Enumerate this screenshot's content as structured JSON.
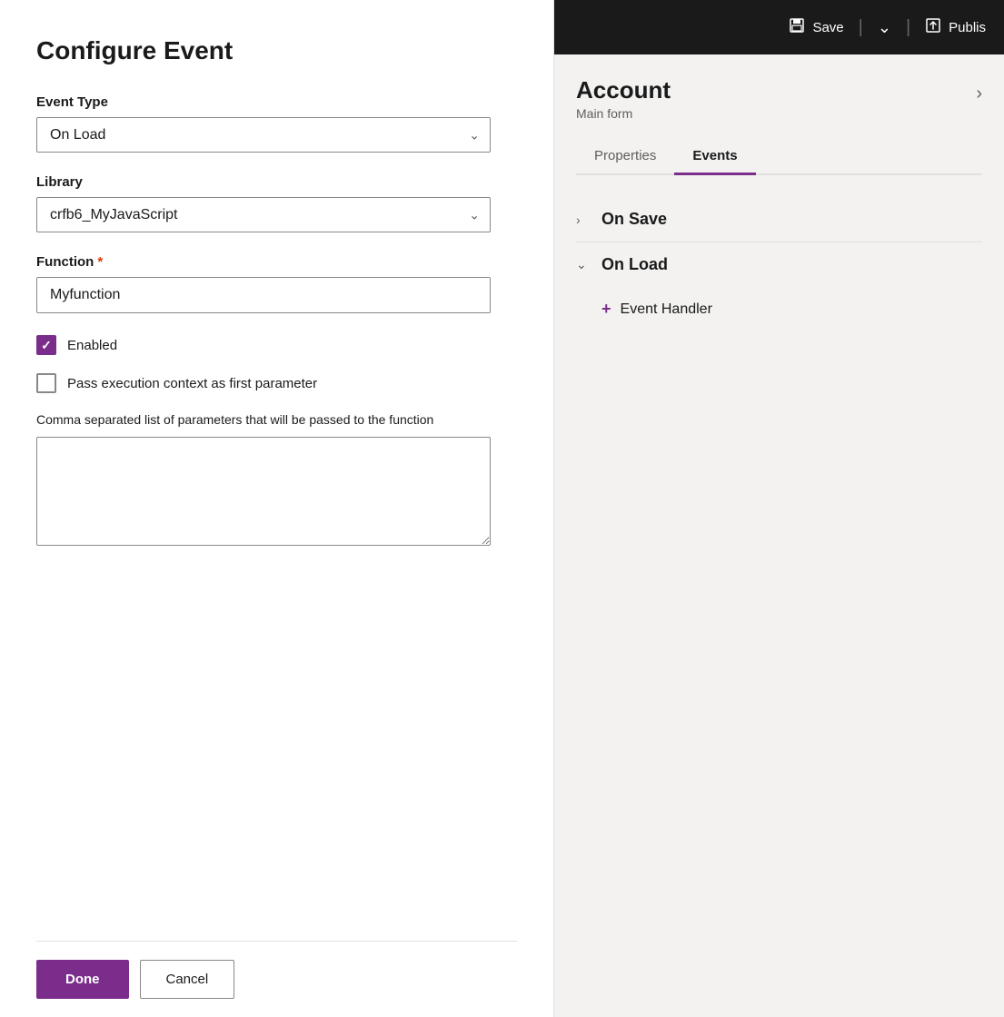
{
  "dialog": {
    "title": "Configure Event",
    "event_type_label": "Event Type",
    "event_type_value": "On Load",
    "library_label": "Library",
    "library_value": "crfb6_MyJavaScript",
    "function_label": "Function",
    "function_required": "*",
    "function_value": "Myfunction",
    "enabled_label": "Enabled",
    "enabled_checked": true,
    "pass_context_label": "Pass execution context as first parameter",
    "pass_context_checked": false,
    "params_label": "Comma separated list of parameters that will be passed to the function",
    "params_value": "",
    "done_label": "Done",
    "cancel_label": "Cancel"
  },
  "header": {
    "save_label": "Save",
    "publish_label": "Publis",
    "save_icon": "💾",
    "publish_icon": "📤"
  },
  "right_panel": {
    "account_title": "Account",
    "account_subtitle": "Main form",
    "tab_properties": "Properties",
    "tab_events": "Events",
    "on_save_label": "On Save",
    "on_load_label": "On Load",
    "add_handler_label": "Event Handler"
  }
}
